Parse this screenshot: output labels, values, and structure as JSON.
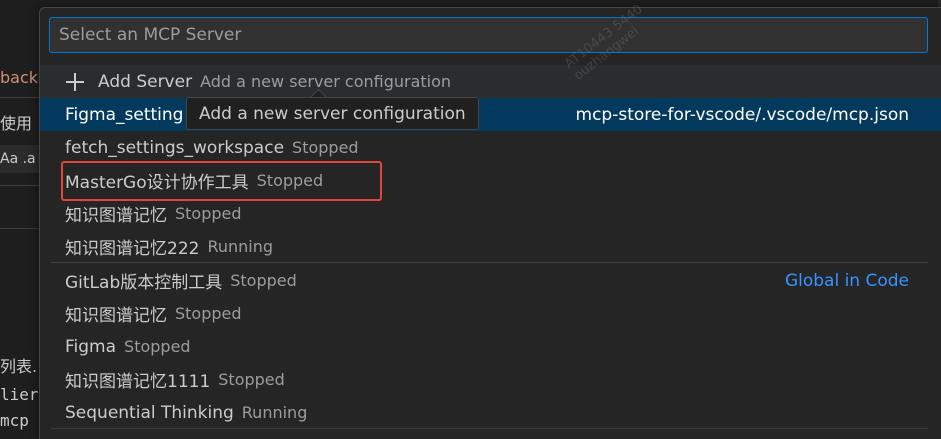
{
  "background_editor": {
    "fragments": [
      "backa",
      "使用",
      "Aa .a",
      "列表.",
      "lier",
      "mcp"
    ]
  },
  "quick_pick": {
    "placeholder": "Select an MCP Server",
    "add_server": {
      "label": "Add Server",
      "description": "Add a new server configuration",
      "icon": "plus-icon"
    },
    "workspace_group": {
      "detail": "mcp-store-for-vscode/.vscode/mcp.json",
      "items": [
        {
          "label": "Figma_setting",
          "status": ""
        },
        {
          "label": "fetch_settings_workspace",
          "status": "Stopped"
        },
        {
          "label": "MasterGo设计协作工具",
          "status": "Stopped"
        },
        {
          "label": "知识图谱记忆",
          "status": "Stopped"
        },
        {
          "label": "知识图谱记忆222",
          "status": "Running"
        }
      ]
    },
    "global_group": {
      "label": "Global in Code",
      "items": [
        {
          "label": "GitLab版本控制工具",
          "status": "Stopped"
        },
        {
          "label": "知识图谱记忆",
          "status": "Stopped"
        },
        {
          "label": "Figma",
          "status": "Stopped"
        },
        {
          "label": "知识图谱记忆1111",
          "status": "Stopped"
        },
        {
          "label": "Sequential Thinking",
          "status": "Running"
        }
      ]
    }
  },
  "tooltip": {
    "text": "Add a new server configuration"
  },
  "watermark": {
    "line1": "AT10443 5440",
    "line2": "ouzhangwei"
  },
  "colors": {
    "accent": "#0078d4",
    "selection": "#04395e",
    "group_label": "#3794ff",
    "highlight_box": "#e0463a"
  }
}
